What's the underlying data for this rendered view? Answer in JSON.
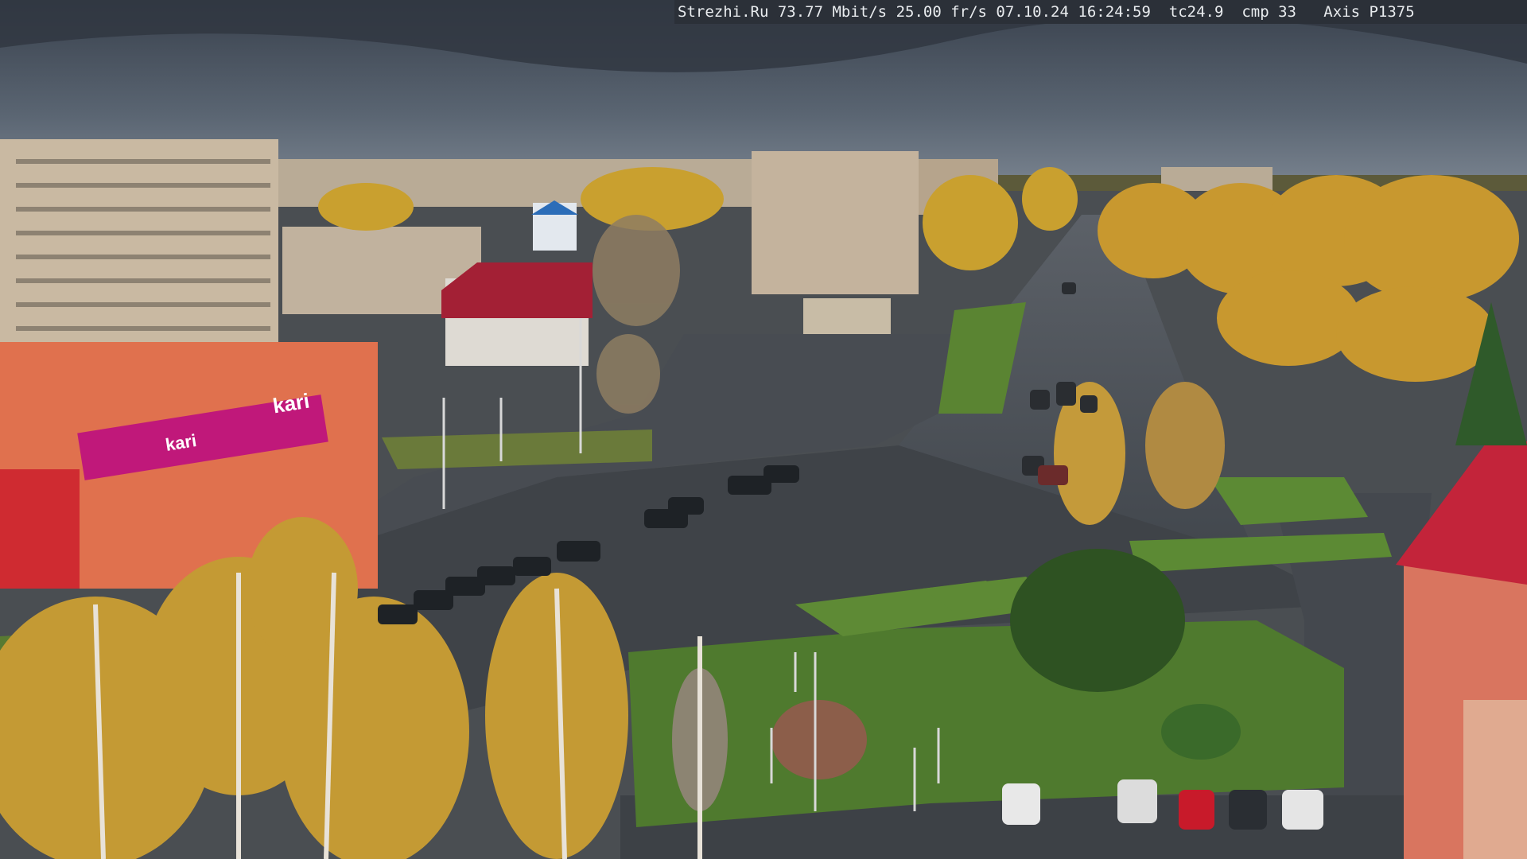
{
  "osd": {
    "site": "Strezhi.Ru",
    "bitrate": "73.77 Mbit/s",
    "framerate": "25.00 fr/s",
    "date": "07.10.24",
    "time": "16:24:59",
    "temperature": "tc24.9",
    "compression": "cmp 33",
    "camera": "Axis P1375"
  },
  "signs": {
    "store_logo": "kari",
    "store_banner": "kari"
  },
  "colors": {
    "sky": "#4a5666",
    "road": "#45494f",
    "grass": "#4f7a2e",
    "foliage": "#c89a2e",
    "brand": "#c0187a"
  }
}
